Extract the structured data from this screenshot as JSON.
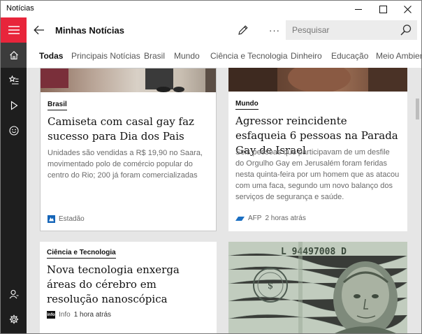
{
  "window": {
    "title": "Notícias"
  },
  "header": {
    "title": "Minhas Notícias",
    "search_placeholder": "Pesquisar"
  },
  "tabs": [
    "Todas",
    "Principais Notícias",
    "Brasil",
    "Mundo",
    "Ciência e Tecnologia",
    "Dinheiro",
    "Educação",
    "Meio Ambiente"
  ],
  "articles": [
    {
      "category": "Brasil",
      "headline": "Camiseta com casal gay faz sucesso para Dia dos Pais",
      "summary": "Unidades são vendidas a R$ 19,90 no Saara, movimentado polo de comércio popular do centro do Rio; 200 já foram comercializadas",
      "source": "Estadão",
      "time": ""
    },
    {
      "category": "Mundo",
      "headline": "Agressor reincidente esfaqueia 6 pessoas na Parada Gay de Israel",
      "summary": "Seis pessoas que participavam de um desfile do Orgulho Gay em Jerusalém foram feridas nesta quinta-feira por um homem que as atacou com uma faca, segundo um novo balanço dos serviços de segurança e saúde.",
      "source": "AFP",
      "time": "2 horas atrás"
    },
    {
      "category": "Ciência e Tecnologia",
      "headline": "Nova tecnologia enxerga áreas do cérebro em resolução nanoscópica",
      "summary": "",
      "source": "Info",
      "time": "1 hora atrás"
    },
    {
      "image": "hundred-dollar-bill-image",
      "banknote_serial": "L 94497008 D"
    }
  ],
  "logos": {
    "info": "info"
  },
  "colors": {
    "accent": "#e8253b",
    "rail": "#1e1e1e",
    "content_bg": "#e6e6e6"
  }
}
